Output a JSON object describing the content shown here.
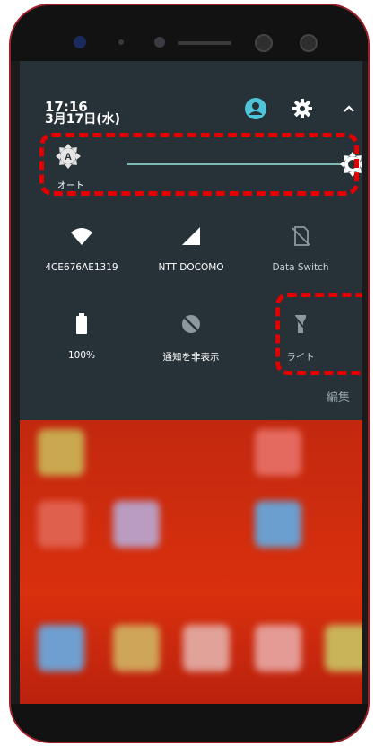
{
  "status": {
    "time": "17:16",
    "date": "3月17日(水)"
  },
  "header_icons": {
    "user": "account-icon",
    "settings": "gear-icon",
    "collapse": "chevron-up-icon"
  },
  "brightness": {
    "auto_label": "オート",
    "auto_icon": "auto-brightness-icon",
    "thumb_icon": "brightness-icon",
    "level": 1.0
  },
  "tiles": [
    {
      "label": "4CE676AE1319",
      "icon": "wifi-icon"
    },
    {
      "label": "NTT DOCOMO",
      "icon": "cellular-signal-icon"
    },
    {
      "label": "Data Switch",
      "icon": "sim-disabled-icon"
    },
    {
      "label": "100%",
      "icon": "battery-icon"
    },
    {
      "label": "通知を非表示",
      "icon": "notifications-hidden-icon"
    },
    {
      "label": "ライト",
      "icon": "flashlight-icon"
    }
  ],
  "edit_label": "編集",
  "colors": {
    "shade": "#273238",
    "accent": "#7fb9b3",
    "highlight": "#e30000",
    "home": "#c2280e"
  }
}
